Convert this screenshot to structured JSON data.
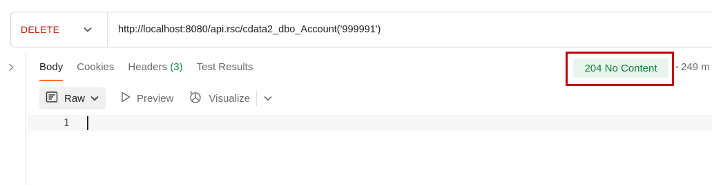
{
  "request": {
    "method": "DELETE",
    "url": "http://localhost:8080/api.rsc/cdata2_dbo_Account('999991')"
  },
  "response": {
    "tabs": [
      {
        "label": "Body",
        "active": true
      },
      {
        "label": "Cookies",
        "active": false
      },
      {
        "label": "Headers",
        "count": "(3)",
        "active": false
      },
      {
        "label": "Test Results",
        "active": false
      }
    ],
    "status": "204 No Content",
    "time": "249 m"
  },
  "toolbar": {
    "format": "Raw",
    "preview": "Preview",
    "visualize": "Visualize"
  },
  "editor": {
    "line_numbers": [
      "1"
    ]
  },
  "colors": {
    "method": "#b8220e",
    "status_text": "#0f7b3a",
    "status_bg": "#e8f5ec",
    "active_tab_underline": "#ff6c37",
    "highlight_box": "#c00000",
    "headers_count": "#0f8a3b"
  },
  "icons": {
    "method_dropdown": "chevron-down-icon",
    "sidebar_toggle": "chevron-right-icon",
    "raw": "document-text-icon",
    "raw_dropdown": "chevron-down-icon",
    "preview": "play-icon",
    "visualize": "visualize-icon",
    "more": "chevron-down-icon"
  }
}
